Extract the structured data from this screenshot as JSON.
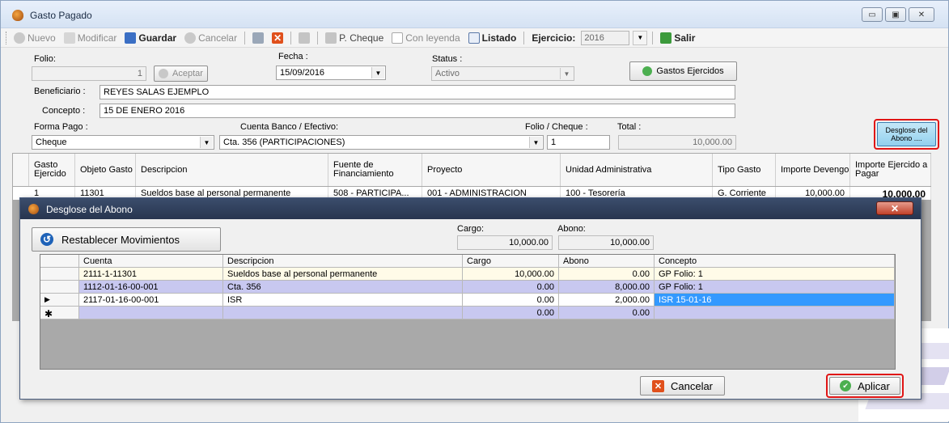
{
  "window": {
    "title": "Gasto Pagado",
    "controls": [
      "▭",
      "▣",
      "✕"
    ]
  },
  "toolbar": {
    "nuevo": "Nuevo",
    "modificar": "Modificar",
    "guardar": "Guardar",
    "cancelar": "Cancelar",
    "p_cheque": "P. Cheque",
    "con_leyenda": "Con leyenda",
    "listado": "Listado",
    "ejercicio_label": "Ejercicio:",
    "ejercicio_value": "2016",
    "salir": "Salir"
  },
  "form": {
    "folio_label": "Folio:",
    "folio_value": "1",
    "aceptar": "Aceptar",
    "fecha_label": "Fecha :",
    "fecha_value": "15/09/2016",
    "status_label": "Status :",
    "status_value": "Activo",
    "gastos_ejercidos": "Gastos Ejercidos",
    "beneficiario_label": "Beneficiario :",
    "beneficiario_value": "REYES SALAS EJEMPLO",
    "concepto_label": "Concepto :",
    "concepto_value": "15 DE ENERO 2016",
    "forma_pago_label": "Forma Pago :",
    "forma_pago_value": "Cheque",
    "cuenta_label": "Cuenta Banco / Efectivo:",
    "cuenta_value": "Cta. 356 (PARTICIPACIONES)",
    "folio_cheque_label": "Folio / Cheque :",
    "folio_cheque_value": "1",
    "total_label": "Total :",
    "total_value": "10,000.00",
    "desglose_btn_l1": "Desglose del",
    "desglose_btn_l2": "Abono ...."
  },
  "grid": {
    "headers": [
      "Gasto Ejercido",
      "Objeto Gasto",
      "Descripcion",
      "Fuente de Financiamiento",
      "Proyecto",
      "Unidad Administrativa",
      "Tipo Gasto",
      "Importe Devengo",
      "Importe Ejercido a Pagar"
    ],
    "row": [
      "1",
      "11301",
      "Sueldos base al personal permanente",
      "508 - PARTICIPA...",
      "001 - ADMINISTRACION",
      "100 - Tesorería",
      "G. Corriente",
      "10,000.00",
      "10,000.00"
    ]
  },
  "dialog": {
    "title": "Desglose del Abono",
    "close": "✕",
    "restablecer": "Restablecer Movimientos",
    "cargo_label": "Cargo:",
    "cargo_value": "10,000.00",
    "abono_label": "Abono:",
    "abono_value": "10,000.00",
    "headers": [
      "Cuenta",
      "Descripcion",
      "Cargo",
      "Abono",
      "Concepto"
    ],
    "rows": [
      {
        "marker": "",
        "cuenta": "2111-1-11301",
        "descripcion": "Sueldos base al personal permanente",
        "cargo": "10,000.00",
        "abono": "0.00",
        "concepto": "GP Folio: 1"
      },
      {
        "marker": "",
        "cuenta": "1112-01-16-00-001",
        "descripcion": "Cta. 356",
        "cargo": "0.00",
        "abono": "8,000.00",
        "concepto": "GP Folio: 1"
      },
      {
        "marker": "▶",
        "cuenta": "2117-01-16-00-001",
        "descripcion": "ISR",
        "cargo": "0.00",
        "abono": "2,000.00",
        "concepto": "ISR 15-01-16"
      },
      {
        "marker": "✱",
        "cuenta": "",
        "descripcion": "",
        "cargo": "0.00",
        "abono": "0.00",
        "concepto": ""
      }
    ],
    "cancelar": "Cancelar",
    "aplicar": "Aplicar"
  },
  "colors": {
    "row_alt": "#c8c8f0",
    "selected": "#3399ff",
    "highlight": "#e01515",
    "dialog_title": "#2f3f5c"
  }
}
